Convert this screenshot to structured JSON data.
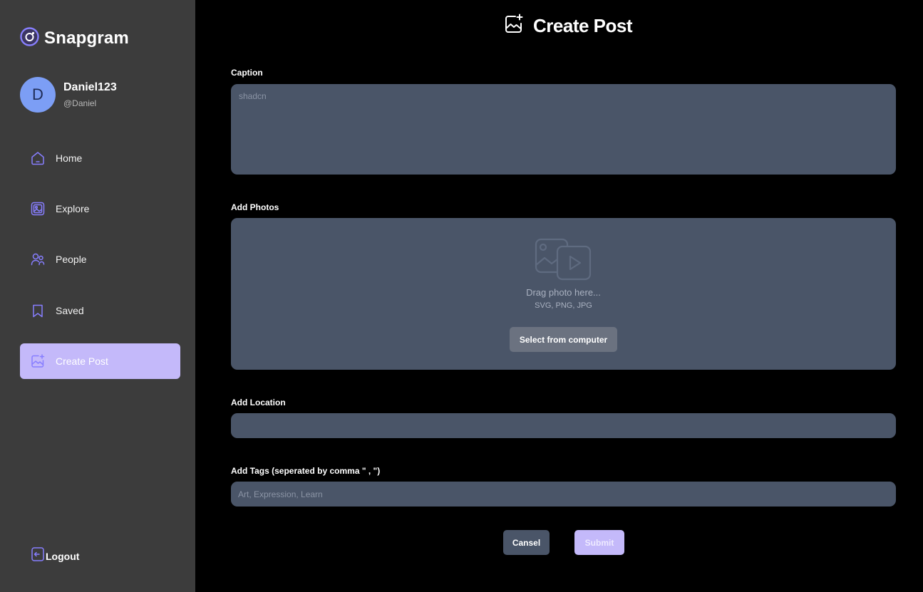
{
  "app": {
    "name": "Snapgram",
    "accent_color": "#877eff",
    "active_color": "#c4b9fa"
  },
  "user": {
    "initial": "D",
    "name": "Daniel123",
    "handle": "@Daniel"
  },
  "sidebar": {
    "items": [
      {
        "label": "Home",
        "icon": "home-icon"
      },
      {
        "label": "Explore",
        "icon": "explore-icon"
      },
      {
        "label": "People",
        "icon": "people-icon"
      },
      {
        "label": "Saved",
        "icon": "saved-icon"
      },
      {
        "label": "Create Post",
        "icon": "create-post-icon",
        "active": true
      }
    ],
    "logout_label": "Logout"
  },
  "page": {
    "title": "Create Post"
  },
  "form": {
    "caption_label": "Caption",
    "caption_placeholder": "shadcn",
    "caption_value": "",
    "photos_label": "Add Photos",
    "drop_title": "Drag photo here...",
    "drop_formats": "SVG, PNG, JPG",
    "select_button": "Select from computer",
    "location_label": "Add Location",
    "location_value": "",
    "tags_label": "Add Tags (seperated by comma \" , \")",
    "tags_placeholder": "Art, Expression, Learn",
    "tags_value": "",
    "cancel_button": "Cansel",
    "submit_button": "Submit"
  }
}
